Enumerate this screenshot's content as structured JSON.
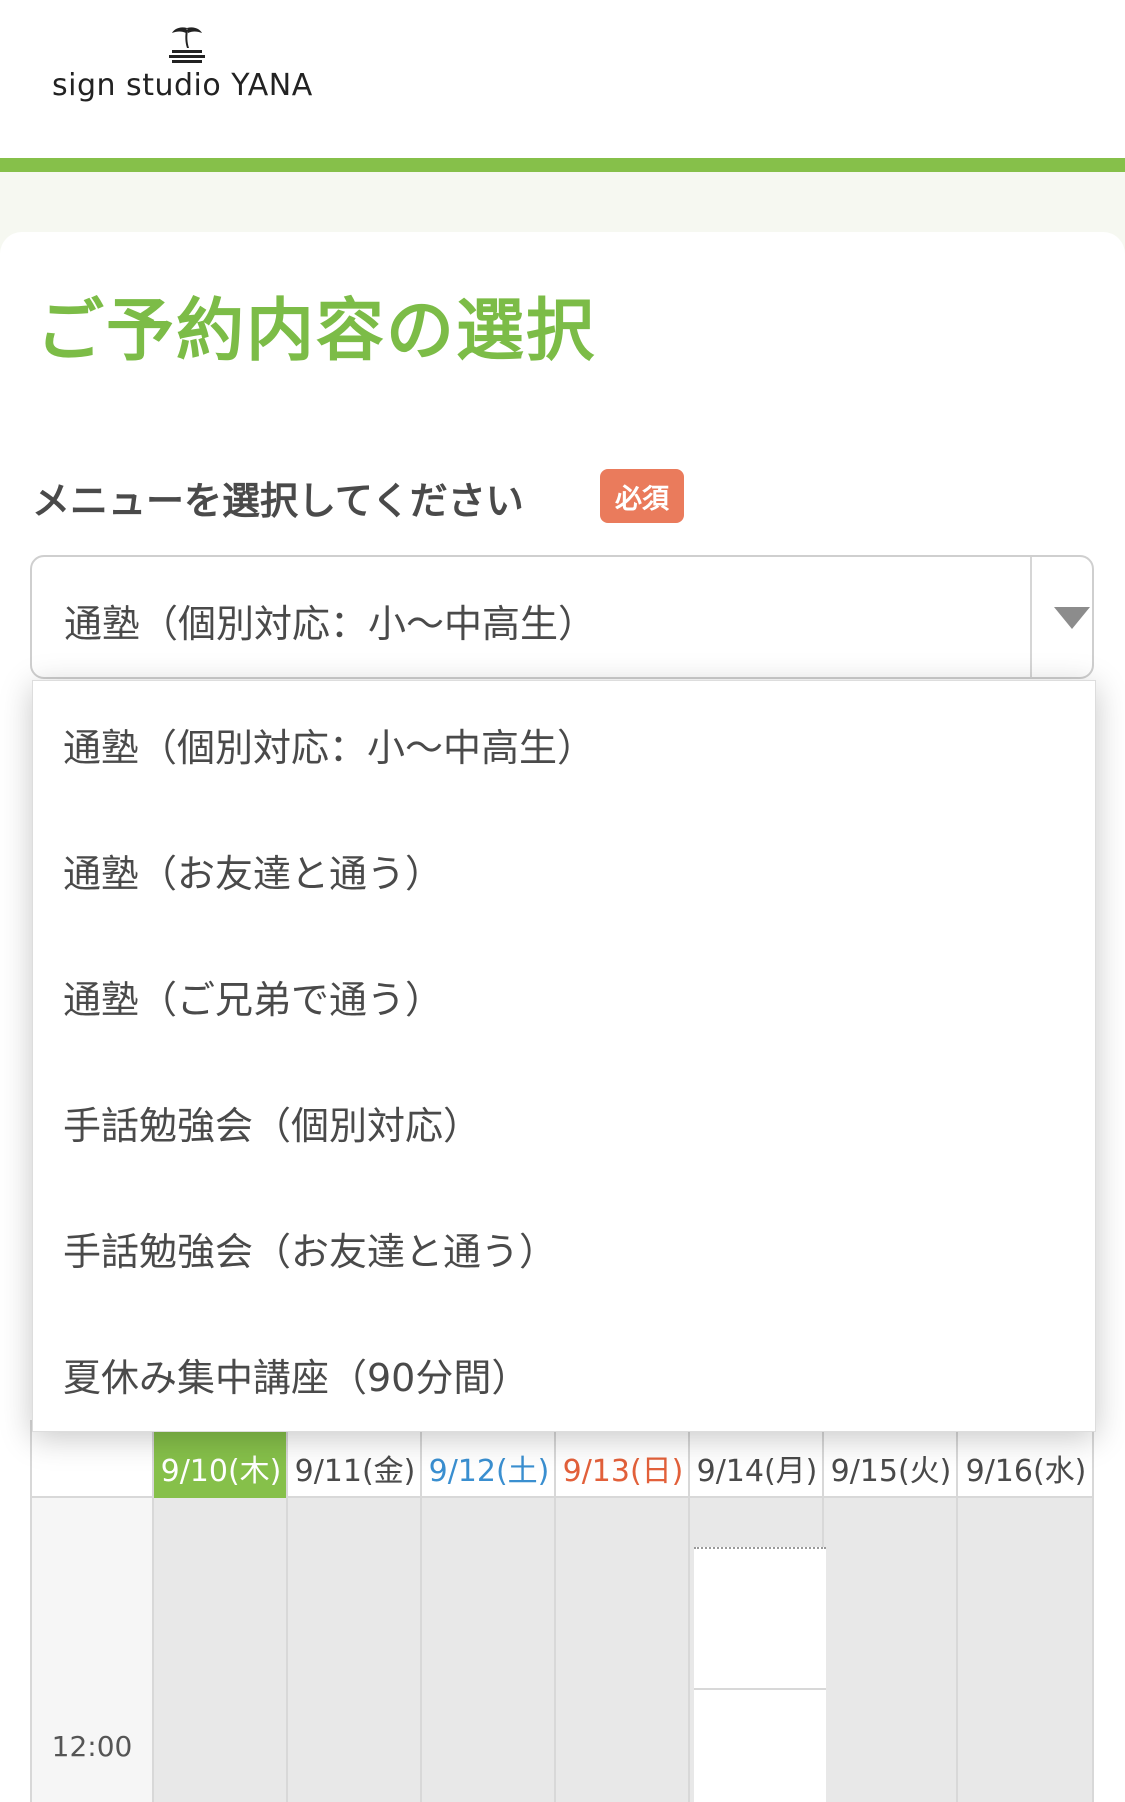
{
  "header": {
    "logo_text": "sign studio YANA"
  },
  "page": {
    "title": "ご予約内容の選択"
  },
  "menu_field": {
    "label": "メニューを選択してください",
    "required_badge": "必須",
    "selected_value": "通塾（個別対応：小〜中高生）",
    "options": [
      "通塾（個別対応：小〜中高生）",
      "通塾（お友達と通う）",
      "通塾（ご兄弟で通う）",
      "手話勉強会（個別対応）",
      "手話勉強会（お友達と通う）",
      "夏休み集中講座（90分間）"
    ]
  },
  "calendar": {
    "dates": [
      "9/10(木)",
      "9/11(金)",
      "9/12(土)",
      "9/13(日)",
      "9/14(月)",
      "9/15(火)",
      "9/16(水)"
    ],
    "time_slot": "12:00"
  },
  "colors": {
    "accent_green": "#86c04a",
    "title_green": "#7cbc47",
    "required_badge": "#ea7b5c",
    "saturday_blue": "#3a8fd0",
    "sunday_red": "#e2603a"
  },
  "icons": {
    "logo_palm": "palm-tree-island-icon",
    "select_arrow": "triangle-down-icon"
  }
}
